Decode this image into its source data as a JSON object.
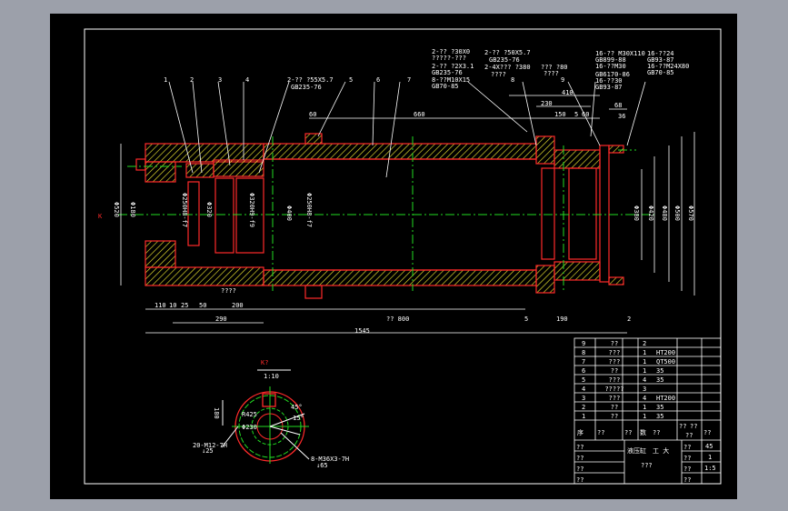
{
  "view_label": "K",
  "part_labels": [
    "1",
    "2",
    "3",
    "4",
    "5",
    "6",
    "7",
    "8",
    "9"
  ],
  "callouts": {
    "c1": [
      "2-?? ?55X5.7",
      "GB235-76"
    ],
    "c8": [
      "2-?? ?30X0",
      "?????-???",
      "2-?? ?2X3.1",
      "GB235-76",
      "8-??M10X15",
      "GB70-85"
    ],
    "c8b": [
      "2-?? ?50X5.7",
      "GB235-76",
      "2-4X??? ?380",
      "????"
    ],
    "c9": [
      "??? ?80",
      "????"
    ],
    "c10": [
      "16-?? M30X110",
      "GB899-88",
      "16-??M30",
      "GB6170-86",
      "16-??30",
      "GB93-87"
    ],
    "c11": [
      "16-??24",
      "GB93-87",
      "16-??M24X80",
      "GB70-85"
    ]
  },
  "dims": {
    "d60a": "60",
    "d660": "660",
    "d410": "410",
    "d230": "230",
    "d150": "150",
    "d5a": "5",
    "d60b": "60",
    "d68": "68",
    "d36": "36",
    "d110": "110",
    "d10": "10",
    "d25": "25",
    "d50": "50",
    "d200": "200",
    "d290": "290",
    "d800": "?? 800",
    "d5b": "5",
    "d190": "190",
    "d2": "2",
    "d1545": "1545",
    "phi520": "Φ520",
    "phi180": "Φ180",
    "phi400": "Φ400",
    "phi380": "Φ380",
    "phi320": "Φ320",
    "phi420": "Φ420",
    "phi480": "Φ480",
    "phi500": "Φ500",
    "phi570": "Φ570",
    "fit1": "Φ250H8-f7",
    "fit2": "Φ250H8-f7",
    "fit3": "Φ320H9-f9",
    "note": "????"
  },
  "detail": {
    "title": "K?",
    "scale": "1:10",
    "d180": "180",
    "r1": "R425",
    "r2": "Φ230",
    "a1": "45°",
    "a2": "15°",
    "hole1": [
      "20-M12-7H",
      "↓25"
    ],
    "hole2": [
      "8-M36X3-7H",
      "↓65"
    ]
  },
  "bom": {
    "rows": [
      {
        "no": "9",
        "name": "??",
        "qty": "2",
        "mat": ""
      },
      {
        "no": "8",
        "name": "???",
        "qty": "1",
        "mat": "HT200"
      },
      {
        "no": "7",
        "name": "???",
        "qty": "1",
        "mat": "QT500"
      },
      {
        "no": "6",
        "name": "??",
        "qty": "1",
        "mat": "35"
      },
      {
        "no": "5",
        "name": "???",
        "qty": "4",
        "mat": "35"
      },
      {
        "no": "4",
        "name": "?????",
        "qty": "3",
        "mat": ""
      },
      {
        "no": "3",
        "name": "???",
        "qty": "4",
        "mat": "HT200"
      },
      {
        "no": "2",
        "name": "??",
        "qty": "1",
        "mat": "35"
      },
      {
        "no": "1",
        "name": "??",
        "qty": "1",
        "mat": "35"
      }
    ],
    "header": {
      "no": "序",
      "code": "??",
      "name": "??",
      "qty": "数",
      "mat": "??",
      "w1": "??",
      "w2": "??",
      "w3": "??",
      "note": "??"
    }
  },
  "title_block": {
    "l1": "??",
    "l2": "??",
    "l3": "??",
    "l4": "??",
    "drawing": "液压缸",
    "school": "工 大",
    "sub": "???",
    "r1": "??",
    "r2": "??",
    "r3": "??",
    "r4": "??",
    "v1": "45",
    "v2": "1",
    "v3": "1:5"
  },
  "colors": {
    "outline": "#ff2a2a",
    "hatch": "#e8e030",
    "center": "#22dd22",
    "dim": "#ffffff",
    "sheet": "#000000",
    "bg": "#9ca0aa"
  }
}
